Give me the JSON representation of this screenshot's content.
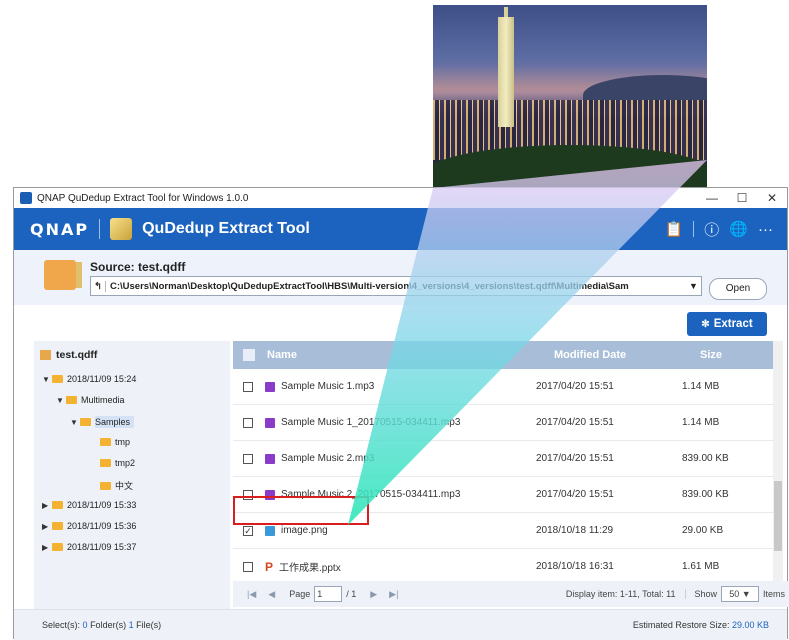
{
  "window": {
    "title": "QNAP QuDedup Extract Tool for Windows 1.0.0",
    "minimize": "—",
    "maximize": "☐",
    "close": "✕"
  },
  "appbar": {
    "logo": "QNAP",
    "product_name": "QuDedup Extract Tool",
    "icons": [
      "clipboard-icon",
      "info-icon",
      "globe-icon",
      "more-icon"
    ]
  },
  "source": {
    "label": "Source: test.qdff",
    "back": "↰",
    "path": "C:\\Users\\Norman\\Desktop\\QuDedupExtractTool\\HBS\\Multi-version\\4_versions\\4_versions\\test.qdff\\Multimedia\\Sam",
    "open": "Open",
    "icon_text": "qdff"
  },
  "toolbar": {
    "extract": "Extract"
  },
  "tree": {
    "root": "test.qdff",
    "nodes": [
      {
        "label": "2018/11/09 15:24"
      },
      {
        "label": "Multimedia"
      },
      {
        "label": "Samples"
      },
      {
        "label": "tmp"
      },
      {
        "label": "tmp2"
      },
      {
        "label": "中文"
      },
      {
        "label": "2018/11/09 15:33"
      },
      {
        "label": "2018/11/09 15:36"
      },
      {
        "label": "2018/11/09 15:37"
      }
    ]
  },
  "table": {
    "headers": {
      "name": "Name",
      "modified": "Modified Date",
      "size": "Size"
    },
    "rows": [
      {
        "name": "Sample Music 1.mp3",
        "date": "2017/04/20 15:51",
        "size": "1.14 MB",
        "checked": "",
        "type": "audio"
      },
      {
        "name": "Sample Music 1_20170515-034411.mp3",
        "date": "2017/04/20 15:51",
        "size": "1.14 MB",
        "checked": "",
        "type": "audio"
      },
      {
        "name": "Sample Music 2.mp3",
        "date": "2017/04/20 15:51",
        "size": "839.00 KB",
        "checked": "",
        "type": "audio"
      },
      {
        "name": "Sample Music 2_20170515-034411.mp3",
        "date": "2017/04/20 15:51",
        "size": "839.00 KB",
        "checked": "",
        "type": "audio"
      },
      {
        "name": "image.png",
        "date": "2018/10/18 11:29",
        "size": "29.00 KB",
        "checked": "✓",
        "type": "image"
      },
      {
        "name": "工作成果.pptx",
        "date": "2018/10/18 16:31",
        "size": "1.61 MB",
        "checked": "",
        "type": "pptx"
      }
    ]
  },
  "pager": {
    "page_label": "Page",
    "page": "1",
    "of": "/ 1",
    "display": "Display item: 1-11, Total: 11",
    "show": "Show",
    "per_page": "50",
    "items": "Items",
    "first": "|◀",
    "prev": "◀",
    "next": "▶",
    "last": "▶|"
  },
  "status": {
    "selected_prefix": "Select(s):",
    "folders": "0",
    "folders_label": "Folder(s)",
    "files": "1",
    "files_label": "File(s)",
    "restore_label": "Estimated Restore Size:",
    "restore_value": "29.00 KB"
  },
  "colors": {
    "brand": "#1b63bf",
    "highlight": "#d81e1e",
    "beam": "#3fe0c8"
  }
}
